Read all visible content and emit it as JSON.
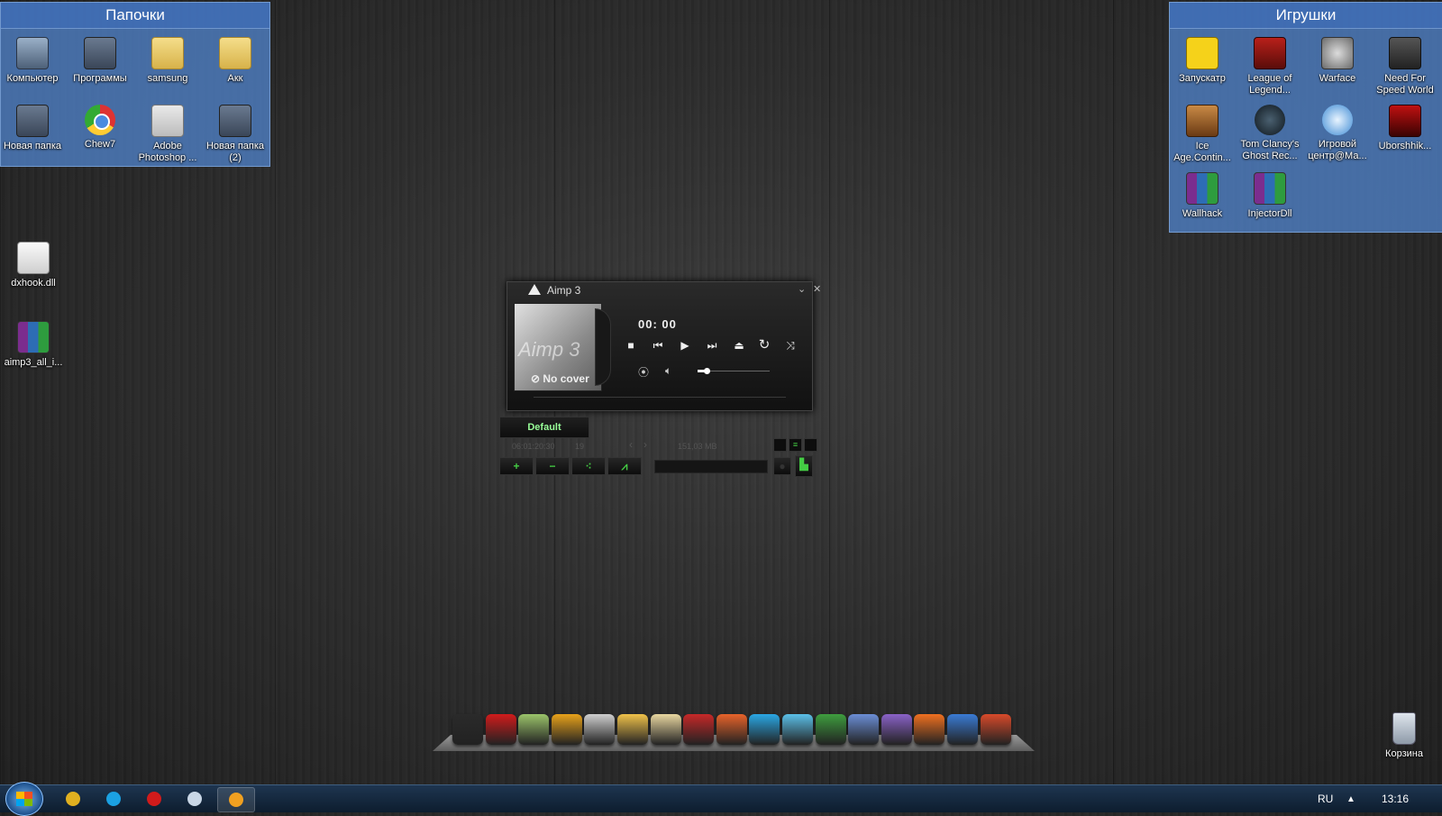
{
  "desktop": {
    "fence_left": {
      "title": "Папочки",
      "icons": [
        {
          "label": "Компьютер",
          "icon": "computer-icon"
        },
        {
          "label": "Программы",
          "icon": "folder-icon"
        },
        {
          "label": "samsung",
          "icon": "folder-icon"
        },
        {
          "label": "Акк",
          "icon": "folder-icon"
        },
        {
          "label": "Новая папка",
          "icon": "folder-icon"
        },
        {
          "label": "Chew7",
          "icon": "chrome-icon"
        },
        {
          "label": "Adobe Photoshop ...",
          "icon": "photoshop-icon"
        },
        {
          "label": "Новая папка (2)",
          "icon": "folder-icon"
        }
      ]
    },
    "fence_right": {
      "title": "Игрушки",
      "icons": [
        {
          "label": "Запускатр",
          "icon": "launcher-icon"
        },
        {
          "label": "League of Legend...",
          "icon": "league-of-legends-icon"
        },
        {
          "label": "Warface",
          "icon": "warface-icon"
        },
        {
          "label": "Need For Speed World",
          "icon": "need-for-speed-icon"
        },
        {
          "label": "Ice Age.Contin...",
          "icon": "ice-age-icon"
        },
        {
          "label": "Tom Clancy's Ghost Rec...",
          "icon": "ghost-recon-icon"
        },
        {
          "label": "Игровой центр@Ма...",
          "icon": "game-center-icon"
        },
        {
          "label": "Uborshhik...",
          "icon": "uborshhik-icon"
        },
        {
          "label": "Wallhack",
          "icon": "winrar-icon"
        },
        {
          "label": "InjectorDll",
          "icon": "winrar-icon"
        }
      ]
    },
    "loose_icons": [
      {
        "label": "dxhook.dll",
        "icon": "dll-file-icon"
      },
      {
        "label": "aimp3_all_i...",
        "icon": "winrar-icon"
      }
    ],
    "recycle_bin": {
      "label": "Корзина",
      "icon": "recycle-bin-icon"
    }
  },
  "player": {
    "title": "Aimp 3",
    "cover_watermark": "Aimp 3",
    "no_cover": "No cover",
    "time": "00: 00",
    "volume": 0.12,
    "playlist_tab": "Default",
    "playlist_duration": "06:01:20:30",
    "playlist_count": "19",
    "playlist_size": "151,03 MB",
    "buttons": {
      "add": "+",
      "remove": "−"
    },
    "icons": [
      "stop-icon",
      "previous-icon",
      "play-icon",
      "next-icon",
      "eject-icon",
      "repeat-icon",
      "shuffle-icon",
      "radio-icon",
      "speaker-icon"
    ]
  },
  "dock": {
    "items": [
      {
        "name": "media-player",
        "color": "#2a2a2a"
      },
      {
        "name": "opera",
        "color": "#d11b1b"
      },
      {
        "name": "notes",
        "color": "#9bc46a"
      },
      {
        "name": "aimp",
        "color": "#e8a21a"
      },
      {
        "name": "printer",
        "color": "#cfcfcf"
      },
      {
        "name": "editor",
        "color": "#f0c24a"
      },
      {
        "name": "writer",
        "color": "#e9d7a0"
      },
      {
        "name": "paint",
        "color": "#c62828"
      },
      {
        "name": "kaspersky",
        "color": "#e8632a"
      },
      {
        "name": "skype",
        "color": "#2aa7e4"
      },
      {
        "name": "copy",
        "color": "#5bc0e8"
      },
      {
        "name": "utorrent",
        "color": "#3e9d3e"
      },
      {
        "name": "chrome",
        "color": "#6b8ed6"
      },
      {
        "name": "visual-studio",
        "color": "#8a62c8"
      },
      {
        "name": "clownfish",
        "color": "#f07020"
      },
      {
        "name": "flash",
        "color": "#3a7bd5"
      },
      {
        "name": "ccleaner",
        "color": "#d84a2a"
      }
    ]
  },
  "taskbar": {
    "apps": [
      {
        "name": "chrome",
        "color": "#e0b020",
        "active": false
      },
      {
        "name": "skype",
        "color": "#1ba1e2",
        "active": false
      },
      {
        "name": "opera",
        "color": "#d11b1b",
        "active": false
      },
      {
        "name": "explorer",
        "color": "#c9d7e6",
        "active": false
      },
      {
        "name": "aimp",
        "color": "#f0a020",
        "active": true
      }
    ],
    "language": "RU",
    "clock": "13:16"
  }
}
